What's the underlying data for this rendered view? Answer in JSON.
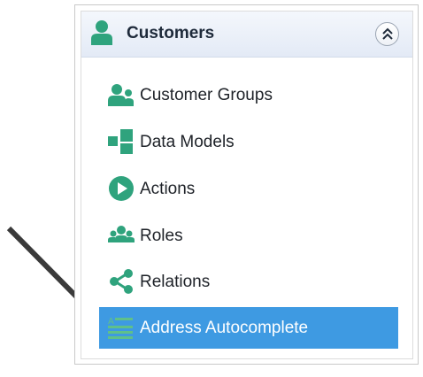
{
  "panel": {
    "title": "Customers",
    "collapse_icon": "double-chevron-up-icon",
    "items": [
      {
        "label": "Customer Groups",
        "icon": "customer-groups-icon",
        "selected": false
      },
      {
        "label": "Data Models",
        "icon": "data-models-icon",
        "selected": false
      },
      {
        "label": "Actions",
        "icon": "play-icon",
        "selected": false
      },
      {
        "label": "Roles",
        "icon": "roles-icon",
        "selected": false
      },
      {
        "label": "Relations",
        "icon": "share-icon",
        "selected": false
      },
      {
        "label": "Address Autocomplete",
        "icon": "address-autocomplete-icon",
        "selected": true
      }
    ]
  },
  "colors": {
    "accent_green": "#2fa37d",
    "selection_blue": "#3e9ae2",
    "header_bg": "#e3eaf6",
    "annotation_arrow": "#3a3a3a"
  },
  "annotation": {
    "icon": "pointer-arrow-icon"
  }
}
